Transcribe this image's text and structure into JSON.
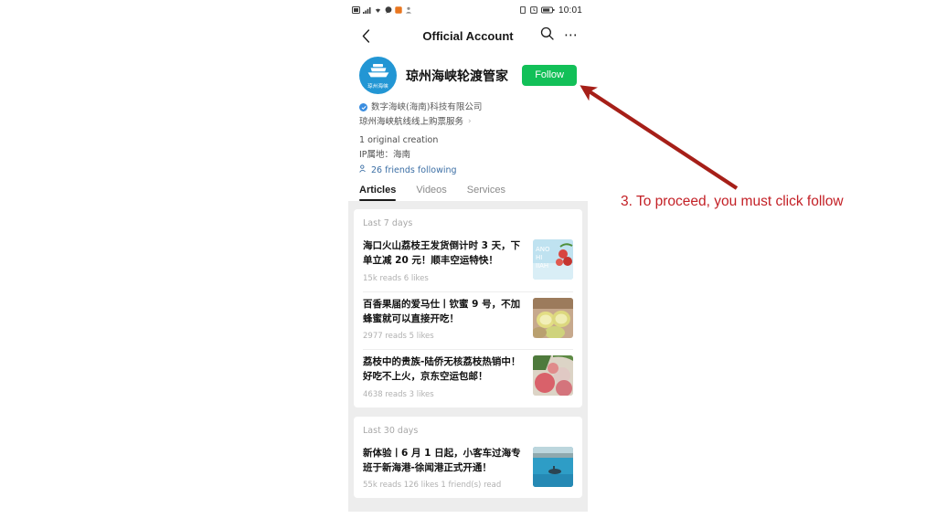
{
  "colors": {
    "wechat_green": "#12c058",
    "annotation_red": "#c32026",
    "avatar_blue": "#2296d4",
    "verified_blue": "#3a8de0",
    "feed_bg": "#ededed"
  },
  "statusbar": {
    "time": "10:01",
    "left_icons": [
      "sim-card-icon",
      "signal-icon",
      "wifi-icon",
      "chat-bubble-icon",
      "app-badge-icon",
      "person-icon"
    ],
    "right_icons": [
      "vibrate-icon",
      "alarm-icon",
      "battery-icon"
    ]
  },
  "navbar": {
    "back_icon": "back-chevron-icon",
    "title": "Official Account",
    "search_icon": "search-icon",
    "more_icon": "more-dots-icon"
  },
  "profile": {
    "avatar_label": "琼州海峡",
    "avatar_icon": "ferry-ship-icon",
    "account_name": "琼州海峡轮渡管家",
    "follow_label": "Follow",
    "verified_icon": "verified-check-icon",
    "company": "数字海峡(海南)科技有限公司",
    "description": "琼州海峡航线线上购票服务",
    "description_chevron": "chevron-right-icon",
    "original_creation": "1 original creation",
    "ip_location": "IP属地：海南",
    "friends_icon": "friends-icon",
    "friends_following": "26 friends following"
  },
  "tabs": [
    {
      "label": "Articles",
      "active": true
    },
    {
      "label": "Videos",
      "active": false
    },
    {
      "label": "Services",
      "active": false
    }
  ],
  "feed": {
    "sections": [
      {
        "header": "Last 7 days",
        "articles": [
          {
            "title": "海口火山荔枝王发货倒计时 3 天，下单立减 20 元！顺丰空运特快！",
            "stats": "15k reads  6 likes",
            "thumb": "lychee-poster-thumbnail"
          },
          {
            "title": "百香果届的爱马仕丨钦蜜 9 号，不加蜂蜜就可以直接开吃！",
            "stats": "2977 reads  5 likes",
            "thumb": "passionfruit-thumbnail"
          },
          {
            "title": "荔枝中的贵族-陆侨无核荔枝热销中！好吃不上火，京东空运包邮！",
            "stats": "4638 reads  3 likes",
            "thumb": "lychee-fruit-thumbnail"
          }
        ]
      },
      {
        "header": "Last 30 days",
        "articles": [
          {
            "title": "新体验丨6 月 1 日起，小客车过海专班于新海港-徐闻港正式开通！",
            "stats": "55k reads  126 likes  1 friend(s) read",
            "thumb": "harbor-sea-thumbnail"
          }
        ]
      }
    ]
  },
  "annotation": {
    "text": "3. To proceed, you must click follow",
    "arrow_name": "red-pointer-arrow"
  }
}
